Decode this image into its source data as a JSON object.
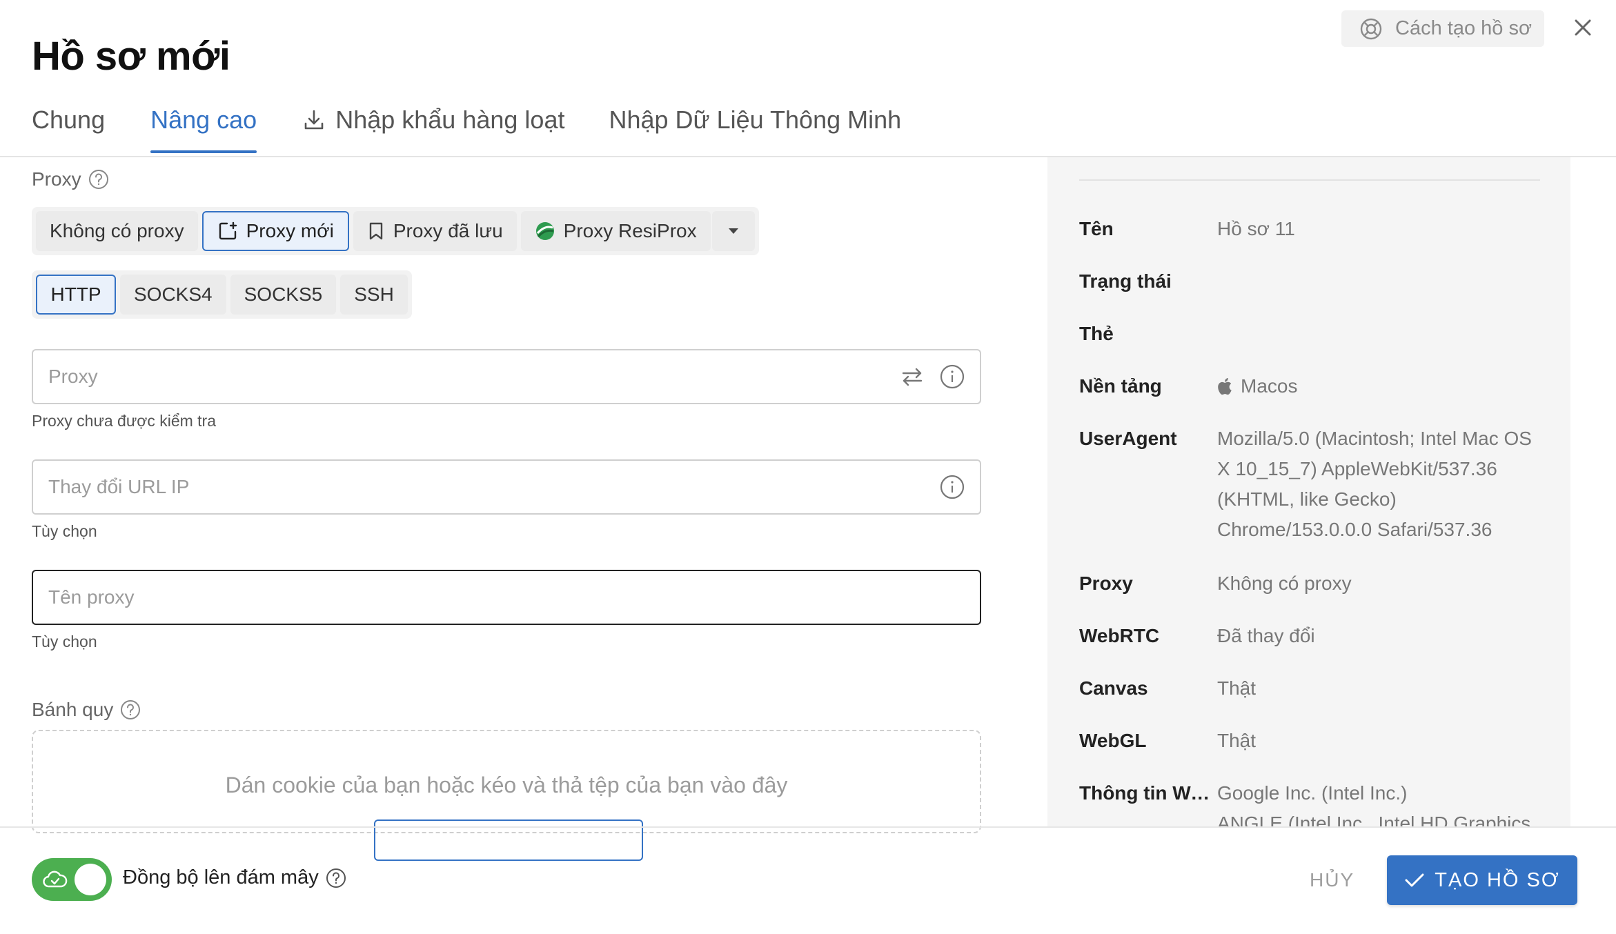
{
  "header": {
    "title": "Hồ sơ mới",
    "help_label": "Cách tạo hồ sơ"
  },
  "tabs": [
    {
      "label": "Chung"
    },
    {
      "label": "Nâng cao"
    },
    {
      "label": "Nhập khẩu hàng loạt"
    },
    {
      "label": "Nhập Dữ Liệu Thông Minh"
    }
  ],
  "proxy": {
    "section_label": "Proxy",
    "modes": [
      {
        "label": "Không có proxy"
      },
      {
        "label": "Proxy mới"
      },
      {
        "label": "Proxy đã lưu"
      },
      {
        "label": "Proxy ResiProx"
      }
    ],
    "types": [
      {
        "label": "HTTP"
      },
      {
        "label": "SOCKS4"
      },
      {
        "label": "SOCKS5"
      },
      {
        "label": "SSH"
      }
    ],
    "proxy_field": {
      "placeholder": "Proxy",
      "helper": "Proxy chưa được kiểm tra"
    },
    "change_ip_field": {
      "placeholder": "Thay đổi URL IP",
      "helper": "Tùy chọn"
    },
    "name_field": {
      "placeholder": "Tên proxy",
      "helper": "Tùy chọn"
    }
  },
  "cookies": {
    "section_label": "Bánh quy",
    "drop_text": "Dán cookie của bạn hoặc kéo và thả tệp của bạn vào đây"
  },
  "summary": {
    "rows": [
      {
        "key": "Tên",
        "value": "Hồ sơ 11"
      },
      {
        "key": "Trạng thái",
        "value": ""
      },
      {
        "key": "Thẻ",
        "value": ""
      },
      {
        "key": "Nền tảng",
        "value": "Macos"
      },
      {
        "key": "UserAgent",
        "value": "Mozilla/5.0 (Macintosh; Intel Mac OS X 10_15_7) AppleWebKit/537.36 (KHTML, like Gecko) Chrome/153.0.0.0 Safari/537.36"
      },
      {
        "key": "Proxy",
        "value": "Không có proxy"
      },
      {
        "key": "WebRTC",
        "value": "Đã thay đổi"
      },
      {
        "key": "Canvas",
        "value": "Thật"
      },
      {
        "key": "WebGL",
        "value": "Thật"
      },
      {
        "key": "Thông tin We...",
        "value": "Google Inc. (Intel Inc.)"
      },
      {
        "key": "",
        "value": "ANGLE (Intel Inc., Intel HD Graphics"
      }
    ]
  },
  "footer": {
    "sync_label": "Đồng bộ lên đám mây",
    "cancel_label": "HỦY",
    "create_label": "TẠO HỒ SƠ"
  }
}
